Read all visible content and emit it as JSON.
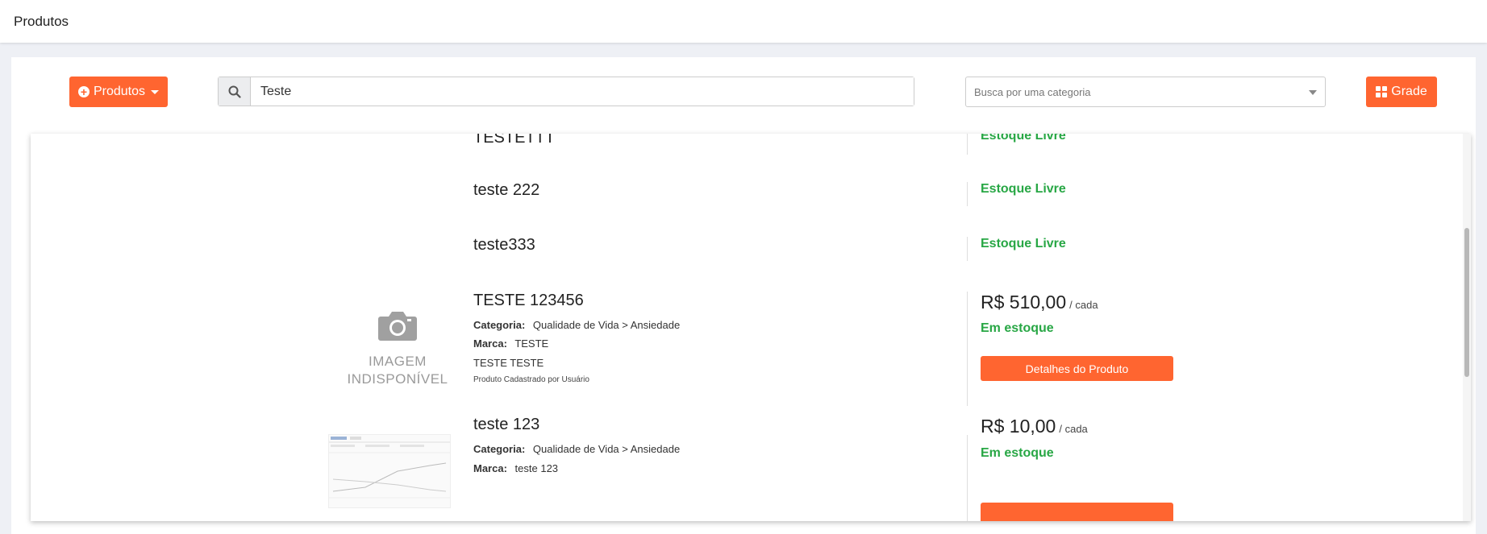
{
  "header": {
    "title": "Produtos"
  },
  "toolbar": {
    "produtos_label": "Produtos",
    "search_value": "Teste",
    "category_placeholder": "Busca por uma categoria",
    "grade_label": "Grade"
  },
  "colors": {
    "accent": "#ff6530",
    "in_stock": "#28a745"
  },
  "products": [
    {
      "name": "TESTETTT",
      "stock": "Estoque Livre"
    },
    {
      "name": "teste 222",
      "stock": "Estoque Livre"
    },
    {
      "name": "teste333",
      "stock": "Estoque Livre"
    },
    {
      "name": "TESTE 123456",
      "category_label": "Categoria:",
      "category": "Qualidade de Vida > Ansiedade",
      "brand_label": "Marca:",
      "brand": "TESTE",
      "description": "TESTE TESTE",
      "note": "Produto Cadastrado por Usuário",
      "price": "R$ 510,00",
      "unit": "/ cada",
      "stock": "Em estoque",
      "button": "Detalhes do Produto",
      "image_text_1": "IMAGEM",
      "image_text_2": "INDISPONÍVEL"
    },
    {
      "name": "teste 123",
      "category_label": "Categoria:",
      "category": "Qualidade de Vida > Ansiedade",
      "brand_label": "Marca:",
      "brand": "teste 123",
      "price": "R$ 10,00",
      "unit": "/ cada",
      "stock": "Em estoque"
    }
  ]
}
